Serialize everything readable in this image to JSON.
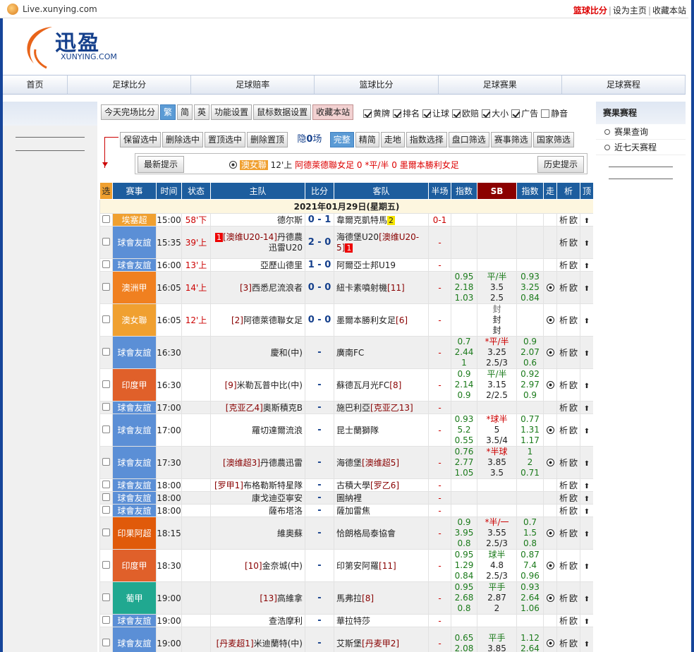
{
  "browser": {
    "url": "Live.xunying.com"
  },
  "toplinks": [
    {
      "label": "篮球比分",
      "hot": true
    },
    {
      "label": "设为主页",
      "hot": false
    },
    {
      "label": "收藏本站",
      "hot": false
    }
  ],
  "logo": {
    "cn": "迅盈",
    "en": "XUNYING.COM"
  },
  "nav": [
    "首页",
    "足球比分",
    "足球赔率",
    "篮球比分",
    "足球赛果",
    "足球赛程"
  ],
  "toolbar1": {
    "buttons": [
      {
        "label": "今天完场比分",
        "active": false
      },
      {
        "label": "繁",
        "active": true
      },
      {
        "label": "简",
        "active": false
      },
      {
        "label": "英",
        "active": false
      },
      {
        "label": "功能设置",
        "active": false
      },
      {
        "label": "鼠标数据设置",
        "active": false
      },
      {
        "label": "收藏本站",
        "active": false,
        "pink": true
      }
    ],
    "options": [
      {
        "label": "黄牌",
        "checked": true
      },
      {
        "label": "排名",
        "checked": true
      },
      {
        "label": "让球",
        "checked": true
      },
      {
        "label": "欧赔",
        "checked": true
      },
      {
        "label": "大小",
        "checked": true
      },
      {
        "label": "广告",
        "checked": true
      },
      {
        "label": "静音",
        "checked": false
      }
    ]
  },
  "toolbar2": {
    "left_buttons": [
      "保留选中",
      "删除选中",
      "置顶选中",
      "删除置顶"
    ],
    "hidden_prefix": "隐",
    "hidden_count": "0",
    "hidden_suffix": "场",
    "right_buttons": [
      {
        "label": "完整",
        "active": true
      },
      {
        "label": "精简",
        "active": false
      },
      {
        "label": "走地",
        "active": false
      },
      {
        "label": "指数选择",
        "active": false
      },
      {
        "label": "盘口筛选",
        "active": false
      },
      {
        "label": "赛事筛选",
        "active": false
      },
      {
        "label": "国家筛选",
        "active": false
      }
    ]
  },
  "hintbar": {
    "latest_label": "最新提示",
    "history_label": "历史提示",
    "league": "澳女聯",
    "time": "12'上",
    "home": "阿德萊德聯女足",
    "home_score": "0",
    "handicap": "*平/半",
    "away_score": "0",
    "away": "墨爾本勝利女足"
  },
  "table": {
    "headers": [
      "选",
      "赛事",
      "时间",
      "状态",
      "主队",
      "比分",
      "客队",
      "半场",
      "指数",
      "SB",
      "指数",
      "走",
      "析",
      "顶"
    ],
    "date_label": "2021年01月29日(星期五)",
    "colors": {
      "friendly": "#5b8fd6",
      "egypt": "#f0a030",
      "aus": "#f08020",
      "ausw": "#f0a030",
      "india": "#e0602a",
      "thai": "#e05a0a",
      "pt": "#20a890"
    },
    "rows": [
      {
        "league": "埃塞超",
        "color": "#f0a030",
        "time": "15:00",
        "status": "58'下",
        "home_rank": "",
        "home": "德尔斯",
        "score": "0 - 1",
        "away": "韋爾克凱特馬",
        "away_rank": "",
        "away_card": "2",
        "away_card_type": "yellow",
        "half": "0-1",
        "o1": "",
        "sb": "",
        "o2": "",
        "ball": false,
        "tall": false
      },
      {
        "league": "球會友誼",
        "color": "#5b8fd6",
        "time": "15:35",
        "status": "39'上",
        "home_card": "1",
        "home_rank": "[澳维U20-14]",
        "home": "丹德農迅雷U20",
        "score": "2 - 0",
        "away": "海德堡U20",
        "away_rank": "[澳维U20-5]",
        "away_card": "1",
        "away_card_type": "red",
        "half": "-",
        "o1": "",
        "sb": "",
        "o2": "",
        "ball": false,
        "tall": true
      },
      {
        "league": "球會友誼",
        "color": "#5b8fd6",
        "time": "16:00",
        "status": "13'上",
        "home_rank": "",
        "home": "亞歷山德里",
        "score": "1 - 0",
        "away": "阿爾亞士邦U19",
        "away_rank": "",
        "half": "-",
        "o1": "",
        "sb": "",
        "o2": "",
        "ball": false,
        "tall": false
      },
      {
        "league": "澳洲甲",
        "color": "#f08020",
        "time": "16:05",
        "status": "14'上",
        "home_rank": "[3]",
        "home": "西悉尼流浪者",
        "score": "0 - 0",
        "away": "紐卡素噴射機",
        "away_rank": "[11]",
        "half": "-",
        "o1": [
          "0.95",
          "2.18",
          "1.03"
        ],
        "sb": [
          "平/半",
          "3.5",
          "2.5"
        ],
        "o2": [
          "0.93",
          "3.25",
          "0.84"
        ],
        "ball": true,
        "tall": true
      },
      {
        "league": "澳女聯",
        "color": "#f0a030",
        "time": "16:05",
        "status": "12'上",
        "home_rank": "[2]",
        "home": "阿德萊德聯女足",
        "score": "0 - 0",
        "away": "墨爾本勝利女足",
        "away_rank": "[6]",
        "half": "-",
        "o1": "",
        "sb": [
          "封",
          "封",
          "封"
        ],
        "sb_gray": true,
        "o2": "",
        "ball": true,
        "tall": true
      },
      {
        "league": "球會友誼",
        "color": "#5b8fd6",
        "time": "16:30",
        "status": "",
        "home_rank": "",
        "home": "慶和(中)",
        "score": "-",
        "away": "廣南FC",
        "away_rank": "",
        "half": "-",
        "o1": [
          "0.7",
          "2.44",
          "1"
        ],
        "sb": [
          "*平/半",
          "3.25",
          "2.5/3"
        ],
        "sb_red": true,
        "o2": [
          "0.9",
          "2.07",
          "0.6"
        ],
        "ball": true,
        "tall": true
      },
      {
        "league": "印度甲",
        "color": "#e0602a",
        "time": "16:30",
        "status": "",
        "home_rank": "[9]",
        "home": "米勒瓦普中比(中)",
        "score": "-",
        "away": "蘇德瓦月光FC",
        "away_rank": "[8]",
        "half": "-",
        "o1": [
          "0.9",
          "2.14",
          "0.9"
        ],
        "sb": [
          "平/半",
          "3.15",
          "2/2.5"
        ],
        "o2": [
          "0.92",
          "2.97",
          "0.9"
        ],
        "ball": true,
        "tall": true
      },
      {
        "league": "球會友誼",
        "color": "#5b8fd6",
        "time": "17:00",
        "status": "",
        "home_rank": "[克亚乙4]",
        "home": "奧斯積克B",
        "score": "-",
        "away": "施巴利亞",
        "away_rank": "[克亚乙13]",
        "half": "-",
        "o1": "",
        "sb": "",
        "o2": "",
        "ball": false,
        "tall": false
      },
      {
        "league": "球會友誼",
        "color": "#5b8fd6",
        "time": "17:00",
        "status": "",
        "home_rank": "",
        "home": "羅切達爾流浪",
        "score": "-",
        "away": "昆士蘭獅隊",
        "away_rank": "",
        "half": "-",
        "o1": [
          "0.93",
          "5.2",
          "0.55"
        ],
        "sb": [
          "*球半",
          "5",
          "3.5/4"
        ],
        "sb_red": true,
        "o2": [
          "0.77",
          "1.31",
          "1.17"
        ],
        "ball": true,
        "tall": true
      },
      {
        "league": "球會友誼",
        "color": "#5b8fd6",
        "time": "17:30",
        "status": "",
        "home_rank": "[澳维超3]",
        "home": "丹德農迅雷",
        "score": "-",
        "away": "海德堡",
        "away_rank": "[澳维超5]",
        "half": "-",
        "o1": [
          "0.76",
          "2.77",
          "1.05"
        ],
        "sb": [
          "*半球",
          "3.85",
          "3.5"
        ],
        "sb_red": true,
        "o2": [
          "1",
          "2",
          "0.71"
        ],
        "ball": true,
        "tall": true
      },
      {
        "league": "球會友誼",
        "color": "#5b8fd6",
        "time": "18:00",
        "status": "",
        "home_rank": "[罗甲1]",
        "home": "布格勒斯特星隊",
        "score": "-",
        "away": "古積大學",
        "away_rank": "[罗乙6]",
        "half": "-",
        "o1": "",
        "sb": "",
        "o2": "",
        "ball": false,
        "tall": false
      },
      {
        "league": "球會友誼",
        "color": "#5b8fd6",
        "time": "18:00",
        "status": "",
        "home_rank": "",
        "home": "康戈迪亞寧安",
        "score": "-",
        "away": "圖納裡",
        "away_rank": "",
        "half": "-",
        "o1": "",
        "sb": "",
        "o2": "",
        "ball": false,
        "tall": false
      },
      {
        "league": "球會友誼",
        "color": "#5b8fd6",
        "time": "18:00",
        "status": "",
        "home_rank": "",
        "home": "薩布塔洛",
        "score": "-",
        "away": "薩加雷焦",
        "away_rank": "",
        "half": "-",
        "o1": "",
        "sb": "",
        "o2": "",
        "ball": false,
        "tall": false
      },
      {
        "league": "印果阿超",
        "color": "#e05a0a",
        "time": "18:15",
        "status": "",
        "home_rank": "",
        "home": "維奧蘇",
        "score": "-",
        "away": "恰朗格局泰協會",
        "away_rank": "",
        "half": "-",
        "o1": [
          "0.9",
          "3.95",
          "0.8"
        ],
        "sb": [
          "*半/一",
          "3.55",
          "2.5/3"
        ],
        "sb_red": true,
        "o2": [
          "0.7",
          "1.5",
          "0.8"
        ],
        "ball": true,
        "tall": true
      },
      {
        "league": "印度甲",
        "color": "#e0602a",
        "time": "18:30",
        "status": "",
        "home_rank": "[10]",
        "home": "金奈城(中)",
        "score": "-",
        "away": "印第安阿羅",
        "away_rank": "[11]",
        "half": "-",
        "o1": [
          "0.95",
          "1.29",
          "0.84"
        ],
        "sb": [
          "球半",
          "4.8",
          "2.5/3"
        ],
        "o2": [
          "0.87",
          "7.4",
          "0.96"
        ],
        "ball": true,
        "tall": true
      },
      {
        "league": "葡甲",
        "color": "#20a890",
        "time": "19:00",
        "status": "",
        "home_rank": "[13]",
        "home": "高維拿",
        "score": "-",
        "away": "馬弗拉",
        "away_rank": "[8]",
        "half": "-",
        "o1": [
          "0.95",
          "2.68",
          "0.8"
        ],
        "sb": [
          "平手",
          "2.87",
          "2"
        ],
        "o2": [
          "0.93",
          "2.64",
          "1.06"
        ],
        "ball": true,
        "tall": true
      },
      {
        "league": "球會友誼",
        "color": "#5b8fd6",
        "time": "19:00",
        "status": "",
        "home_rank": "",
        "home": "查浩摩利",
        "score": "-",
        "away": "華拉特莎",
        "away_rank": "",
        "half": "-",
        "o1": "",
        "sb": "",
        "o2": "",
        "ball": false,
        "tall": false
      },
      {
        "league": "球會友誼",
        "color": "#5b8fd6",
        "time": "19:00",
        "status": "",
        "home_rank": "[丹麦超1]",
        "home": "米迪蘭特(中)",
        "score": "-",
        "away": "艾斯堡",
        "away_rank": "[丹麦甲2]",
        "half": "-",
        "o1": [
          "0.65",
          "2.08",
          ""
        ],
        "sb": [
          "平手",
          "3.85",
          ""
        ],
        "o2": [
          "1.12",
          "2.64",
          ""
        ],
        "ball": true,
        "tall": true
      }
    ],
    "row_actions": [
      "析",
      "欧"
    ]
  },
  "rightpanel": {
    "title": "赛果赛程",
    "links": [
      "赛果查询",
      "近七天赛程"
    ]
  }
}
